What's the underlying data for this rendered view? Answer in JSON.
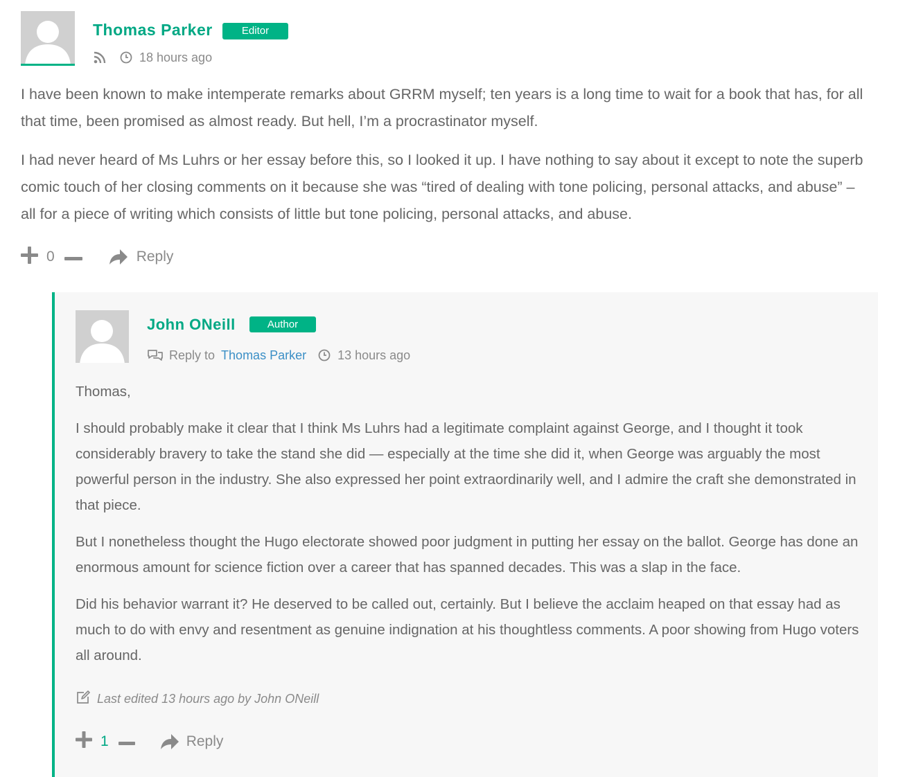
{
  "comment": {
    "author": "Thomas Parker",
    "badge": "Editor",
    "time": "18 hours ago",
    "paragraphs": [
      "I have been known to make intemperate remarks about GRRM myself; ten years is a long time to wait for a book that has, for all that time, been promised as almost ready. But hell, I’m a procrastinator myself.",
      "I had never heard of Ms Luhrs or her essay before this, so I looked it up. I have nothing to say about it except to note the superb comic touch of her closing comments on it because she was “tired of dealing with tone policing, personal attacks, and abuse” – all for a piece of writing which consists of little but tone policing, personal attacks, and abuse."
    ],
    "vote_count": "0",
    "reply_label": "Reply"
  },
  "reply": {
    "author": "John ONeill",
    "badge": "Author",
    "reply_to_label": "Reply to",
    "reply_to_name": "Thomas Parker",
    "time": "13 hours ago",
    "paragraphs": [
      "Thomas,",
      "I should probably make it clear that I think Ms Luhrs had a legitimate complaint against George, and I thought it took considerably bravery to take the stand she did — especially at the time she did it, when George was arguably the most powerful person in the industry. She also expressed her point extraordinarily well, and I admire the craft she demonstrated in that piece.",
      "But I nonetheless thought the Hugo electorate showed poor judgment in putting her essay on the ballot. George has done an enormous amount for science fiction over a career that has spanned decades. This was a slap in the face.",
      "Did his behavior warrant it? He deserved to be called out, certainly. But I believe the acclaim heaped on that essay had as much to do with envy and resentment as genuine indignation at his thoughtless comments. A poor showing from Hugo voters all around."
    ],
    "edited_note": "Last edited 13 hours ago by John ONeill",
    "vote_count": "1",
    "reply_label": "Reply"
  },
  "colors": {
    "accent": "#00b386",
    "link": "#3b8fc6",
    "text": "#666666",
    "muted": "#8a8a8a",
    "reply_background": "#f7f7f7"
  },
  "icons": [
    "rss-icon",
    "clock-icon",
    "plus-icon",
    "minus-icon",
    "reply-arrow-icon",
    "chat-bubbles-icon",
    "edit-icon",
    "avatar-placeholder-icon"
  ]
}
